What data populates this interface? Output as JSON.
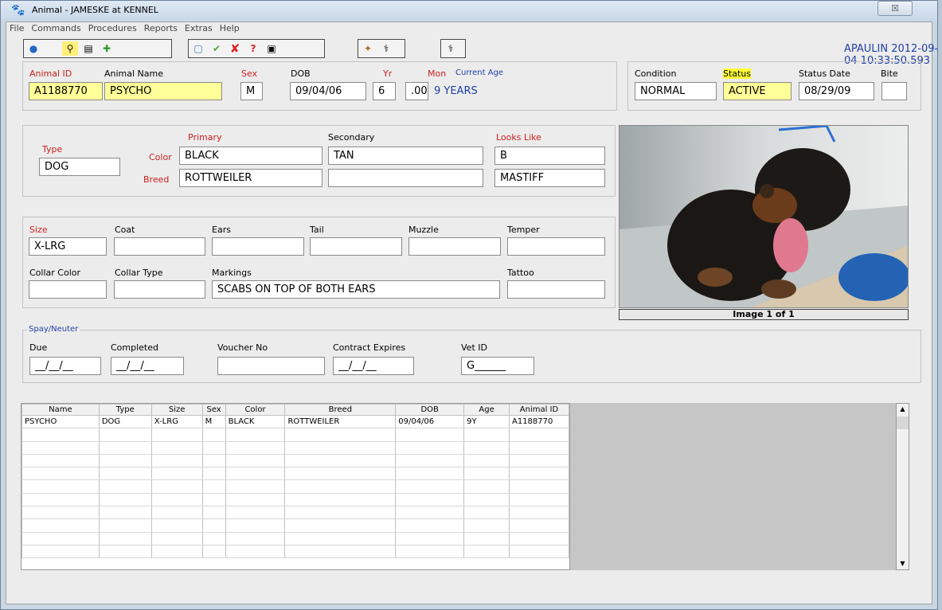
{
  "window": {
    "title": "Animal  -  JAMESKE at KENNEL",
    "close": "☒"
  },
  "menu": [
    "File",
    "Commands",
    "Procedures",
    "Reports",
    "Extras",
    "Help"
  ],
  "toolbar": {
    "icons": [
      "globe-icon",
      "blank-icon",
      "search-icon",
      "copy-icon",
      "add-icon",
      "frame-icon",
      "check-icon",
      "delete-icon",
      "help-icon",
      "page-icon",
      "tools-icon",
      "caduceus-icon",
      "caduceus-icon"
    ]
  },
  "header_text": "APAULIN 2012-09-04 10:33:50.593",
  "top": {
    "animal_id_label": "Animal ID",
    "animal_id": "A1188770",
    "name_label": "Animal Name",
    "name": "PSYCHO",
    "sex_label": "Sex",
    "sex": "M",
    "dob_label": "DOB",
    "dob": "09/04/06",
    "yr_label": "Yr",
    "yr": "6",
    "mon_label": "Mon",
    "mon": ".00",
    "age_label": "Current Age",
    "age": "9 YEARS",
    "condition_label": "Condition",
    "condition": "NORMAL",
    "status_label": "Status",
    "status": "ACTIVE",
    "status_date_label": "Status Date",
    "status_date": "08/29/09",
    "bite_label": "Bite",
    "bite": ""
  },
  "colors": {
    "type_label": "Type",
    "type": "DOG",
    "primary_label": "Primary",
    "secondary_label": "Secondary",
    "looks_label": "Looks Like",
    "color_label": "Color",
    "breed_label": "Breed",
    "primary_color": "BLACK",
    "secondary_color": "TAN",
    "looks_color": "B",
    "primary_breed": "ROTTWEILER",
    "secondary_breed": "",
    "looks_breed": "MASTIFF"
  },
  "physical": {
    "size_label": "Size",
    "size": "X-LRG",
    "coat_label": "Coat",
    "ears_label": "Ears",
    "tail_label": "Tail",
    "muzzle_label": "Muzzle",
    "temper_label": "Temper",
    "collar_color_label": "Collar Color",
    "collar_type_label": "Collar Type",
    "markings_label": "Markings",
    "tattoo_label": "Tattoo",
    "markings": "SCABS ON TOP OF BOTH EARS"
  },
  "image_caption": "Image 1 of 1",
  "spay": {
    "legend": "Spay/Neuter",
    "due_label": "Due",
    "completed_label": "Completed",
    "voucher_label": "Voucher No",
    "contract_label": "Contract Expires",
    "vet_label": "Vet ID",
    "due": "__/__/__",
    "completed": "__/__/__",
    "voucher": "",
    "contract": "__/__/__",
    "vet": "G______"
  },
  "table": {
    "columns": [
      "Name",
      "Type",
      "Size",
      "Sex",
      "Color",
      "Breed",
      "DOB",
      "Age",
      "Animal ID"
    ],
    "rows": [
      [
        "PSYCHO",
        "DOG",
        "X-LRG",
        "M",
        "BLACK",
        "ROTTWEILER",
        "09/04/06",
        "9Y",
        "A1188770"
      ]
    ]
  }
}
